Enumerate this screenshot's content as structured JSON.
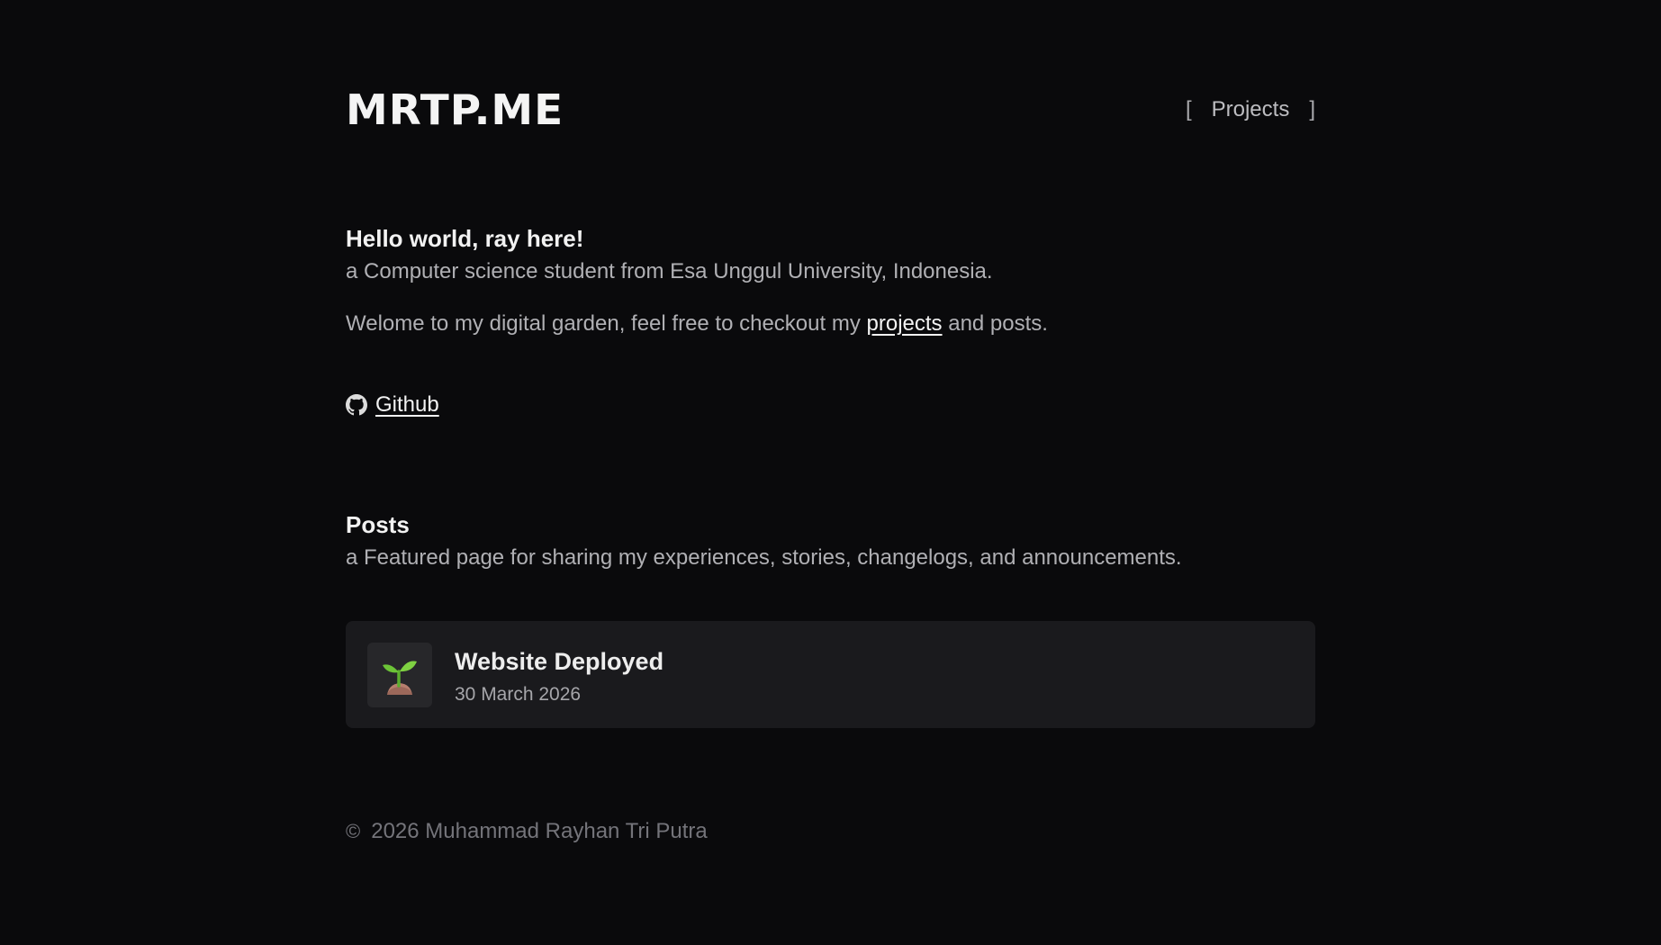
{
  "header": {
    "logo": "MRTP.ME",
    "nav": {
      "bracket_left": "[",
      "projects_label": "Projects",
      "bracket_right": "]"
    }
  },
  "intro": {
    "greeting": "Hello world, ray here!",
    "subtitle": "a Computer science student from Esa Unggul University, Indonesia.",
    "welcome_before": "Welome to my digital garden, feel free to checkout my ",
    "welcome_link": "projects",
    "welcome_after": " and posts."
  },
  "social": {
    "github_label": "Github",
    "github_icon": "github-icon"
  },
  "posts": {
    "heading": "Posts",
    "description": "a Featured page for sharing my experiences, stories, changelogs, and announcements.",
    "items": [
      {
        "icon": "seedling-icon",
        "title": "Website Deployed",
        "date": "30 March 2026"
      }
    ]
  },
  "footer": {
    "copyright_symbol": "©",
    "text": "2026 Muhammad Rayhan Tri Putra"
  },
  "colors": {
    "background": "#0a0a0c",
    "card": "#1a1a1d",
    "text_primary": "#f2f2f2",
    "text_secondary": "#b0b0b4",
    "text_muted": "#74747a"
  }
}
